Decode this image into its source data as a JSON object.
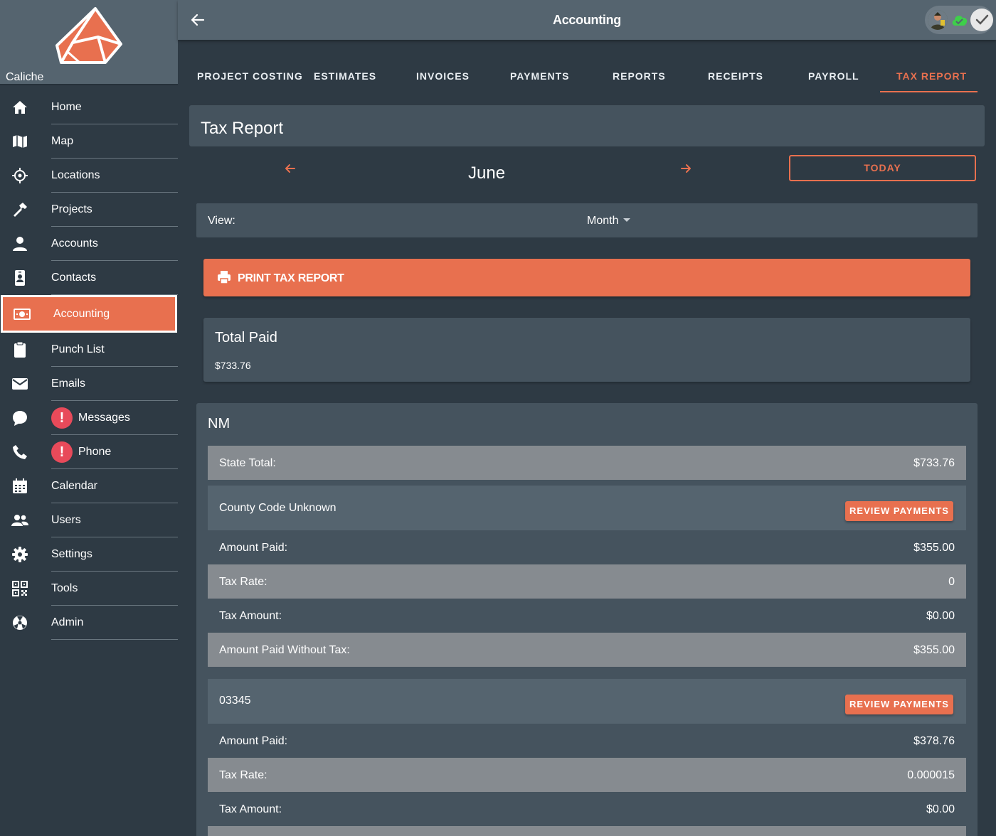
{
  "app": {
    "brand_name": "Caliche"
  },
  "topbar": {
    "title": "Accounting"
  },
  "sidebar": {
    "items": [
      {
        "label": "Home",
        "icon": "home-icon"
      },
      {
        "label": "Map",
        "icon": "map-icon"
      },
      {
        "label": "Locations",
        "icon": "location-crosshair-icon"
      },
      {
        "label": "Projects",
        "icon": "hammer-icon"
      },
      {
        "label": "Accounts",
        "icon": "person-icon"
      },
      {
        "label": "Contacts",
        "icon": "contact-badge-icon"
      },
      {
        "label": "Accounting",
        "icon": "money-icon",
        "active": true
      },
      {
        "label": "Punch List",
        "icon": "clipboard-icon"
      },
      {
        "label": "Emails",
        "icon": "envelope-icon"
      },
      {
        "label": "Messages",
        "icon": "chat-icon",
        "alert": "!"
      },
      {
        "label": "Phone",
        "icon": "phone-icon",
        "alert": "!"
      },
      {
        "label": "Calendar",
        "icon": "calendar-icon"
      },
      {
        "label": "Users",
        "icon": "users-icon"
      },
      {
        "label": "Settings",
        "icon": "gear-icon"
      },
      {
        "label": "Tools",
        "icon": "qr-code-icon"
      },
      {
        "label": "Admin",
        "icon": "admin-icon"
      }
    ]
  },
  "tabs": [
    {
      "label": "PROJECT COSTING"
    },
    {
      "label": "ESTIMATES"
    },
    {
      "label": "INVOICES"
    },
    {
      "label": "PAYMENTS"
    },
    {
      "label": "REPORTS"
    },
    {
      "label": "RECEIPTS"
    },
    {
      "label": "PAYROLL"
    },
    {
      "label": "TAX REPORT",
      "active": true
    }
  ],
  "report": {
    "title": "Tax Report",
    "month": "June",
    "today_label": "TODAY",
    "view_label": "View:",
    "view_value": "Month",
    "print_label": "PRINT TAX REPORT",
    "total_paid_label": "Total Paid",
    "total_paid_value": "$733.76"
  },
  "state": {
    "name": "NM",
    "state_total_label": "State Total:",
    "state_total_value": "$733.76",
    "review_label": "REVIEW PAYMENTS",
    "counties": [
      {
        "name": "County Code Unknown",
        "amount_paid_label": "Amount Paid:",
        "amount_paid": "$355.00",
        "tax_rate_label": "Tax Rate:",
        "tax_rate": "0",
        "tax_amount_label": "Tax Amount:",
        "tax_amount": "$0.00",
        "without_tax_label": "Amount Paid Without Tax:",
        "without_tax": "$355.00"
      },
      {
        "name": "03345",
        "amount_paid_label": "Amount Paid:",
        "amount_paid": "$378.76",
        "tax_rate_label": "Tax Rate:",
        "tax_rate": "0.000015",
        "tax_amount_label": "Tax Amount:",
        "tax_amount": "$0.00"
      }
    ]
  },
  "colors": {
    "accent": "#e8704f",
    "sidebar_bg": "#2e3a44",
    "card_bg": "#45535e",
    "alert": "#e84a5a",
    "cloud_ok": "#3ecf4a"
  }
}
